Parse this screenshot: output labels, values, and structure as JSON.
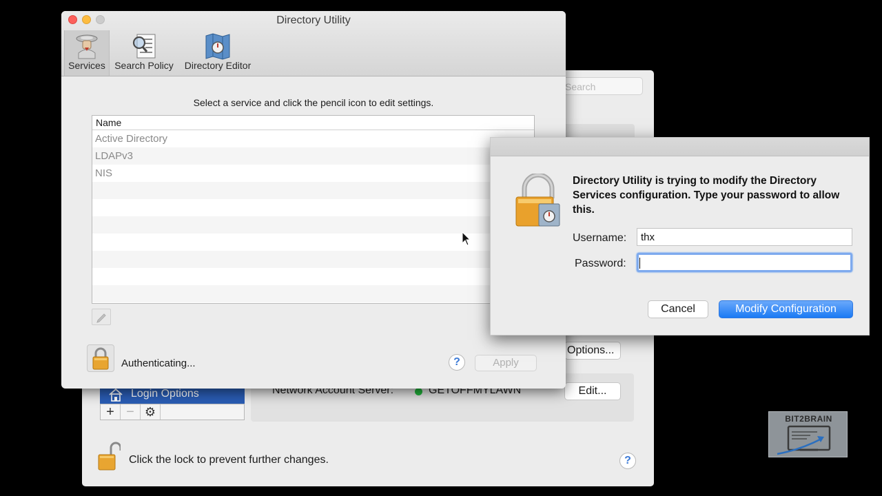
{
  "background_window": {
    "search_placeholder": "Search",
    "sidebar_selected_item": "Login Options",
    "controls": [
      "+",
      "−",
      "⚙"
    ],
    "network_account_server_label": "Network Account Server:",
    "network_account_server_value": "GETOFFMYLAWN",
    "options_button": "Options...",
    "edit_button": "Edit...",
    "lock_message": "Click the lock to prevent further changes.",
    "help_label": "?"
  },
  "directory_utility": {
    "title": "Directory Utility",
    "toolbar": {
      "services": "Services",
      "search_policy": "Search Policy",
      "directory_editor": "Directory Editor"
    },
    "instruction": "Select a service and click the pencil icon to edit settings.",
    "table": {
      "header": "Name",
      "rows": [
        "Active Directory",
        "LDAPv3",
        "NIS",
        "",
        "",
        "",
        "",
        "",
        "",
        ""
      ]
    },
    "auth_status": "Authenticating...",
    "help_label": "?",
    "apply_button": "Apply"
  },
  "auth_dialog": {
    "message": "Directory Utility is trying to modify the Directory Services configuration. Type your password to allow this.",
    "username_label": "Username:",
    "username_value": "thx",
    "password_label": "Password:",
    "password_value": "",
    "cancel_button": "Cancel",
    "confirm_button": "Modify Configuration"
  },
  "watermark": {
    "logo_text": "BIT2BRAIN"
  },
  "colors": {
    "accent_blue": "#1b7af4",
    "selection_blue": "#2a5db5",
    "status_green": "#21b33b",
    "close_red": "#fc605c",
    "minimize_yellow": "#fdbc40"
  }
}
